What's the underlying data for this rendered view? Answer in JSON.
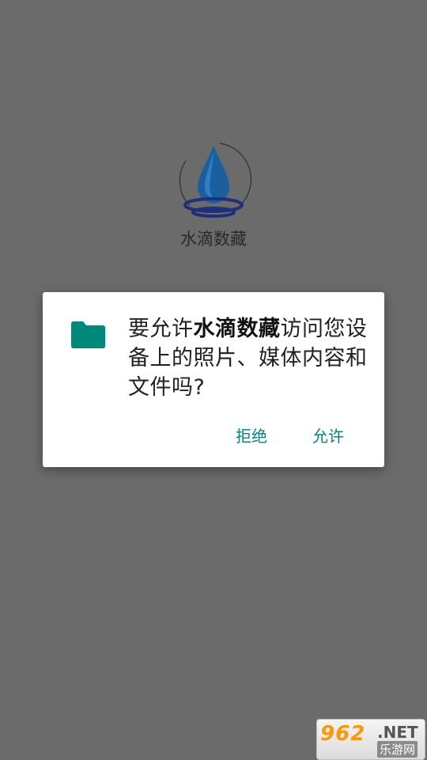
{
  "app": {
    "name": "水滴数藏"
  },
  "dialog": {
    "message_prefix": "要允许",
    "message_app": "水滴数藏",
    "message_suffix": "访问您设备上的照片、媒体内容和文件吗?",
    "deny_label": "拒绝",
    "allow_label": "允许",
    "icon": "folder-icon"
  },
  "watermark": {
    "digits": "962",
    "domain": ".NET",
    "site": "乐游网"
  },
  "colors": {
    "accent": "#00897b",
    "scrim": "#6b6b6b",
    "drop": "#1a5f9e",
    "folder": "#00897b"
  }
}
